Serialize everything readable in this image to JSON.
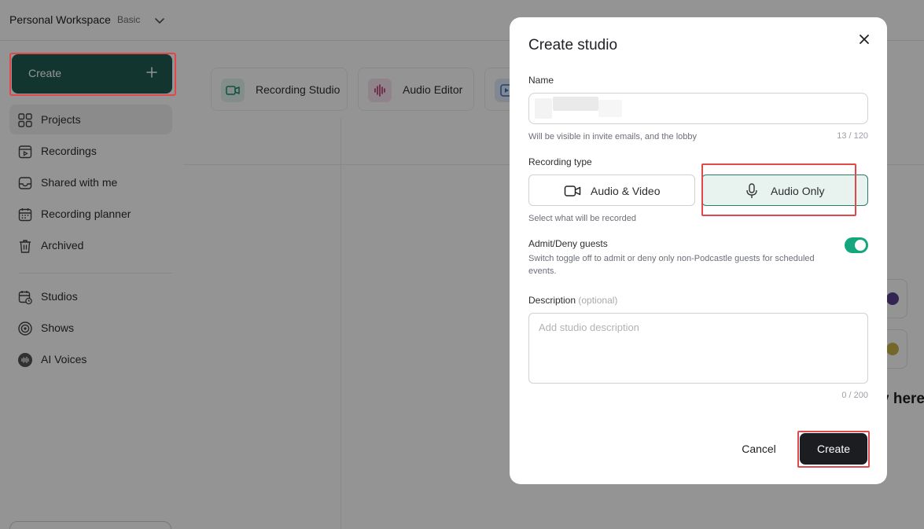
{
  "workspace": {
    "name": "Personal Workspace",
    "plan": "Basic"
  },
  "sidebar": {
    "create_label": "Create",
    "items": [
      {
        "label": "Projects",
        "active": true
      },
      {
        "label": "Recordings"
      },
      {
        "label": "Shared with me"
      },
      {
        "label": "Recording planner"
      },
      {
        "label": "Archived"
      },
      {
        "label": "Studios"
      },
      {
        "label": "Shows"
      },
      {
        "label": "AI Voices"
      }
    ]
  },
  "tools": [
    {
      "label": "Recording Studio"
    },
    {
      "label": "Audio Editor"
    }
  ],
  "background_peek_text": "y here",
  "modal": {
    "title": "Create studio",
    "name_label": "Name",
    "name_help": "Will be visible in invite emails, and the lobby",
    "name_count": "13 / 120",
    "recording_type_label": "Recording type",
    "type_audio_video": "Audio & Video",
    "type_audio_only": "Audio Only",
    "selected_type": "Audio Only",
    "type_help": "Select what will be recorded",
    "admit_label": "Admit/Deny guests",
    "admit_help": "Switch toggle off to admit or deny only non-Podcastle guests for scheduled events.",
    "admit_enabled": true,
    "description_label": "Description",
    "description_optional": "(optional)",
    "description_placeholder": "Add studio description",
    "description_count": "0 / 200",
    "cancel_label": "Cancel",
    "create_label": "Create"
  },
  "colors": {
    "brand": "#1f5d52",
    "toggle_on": "#14a77d",
    "highlight": "#e0484b",
    "primary_button": "#1c1d20"
  }
}
